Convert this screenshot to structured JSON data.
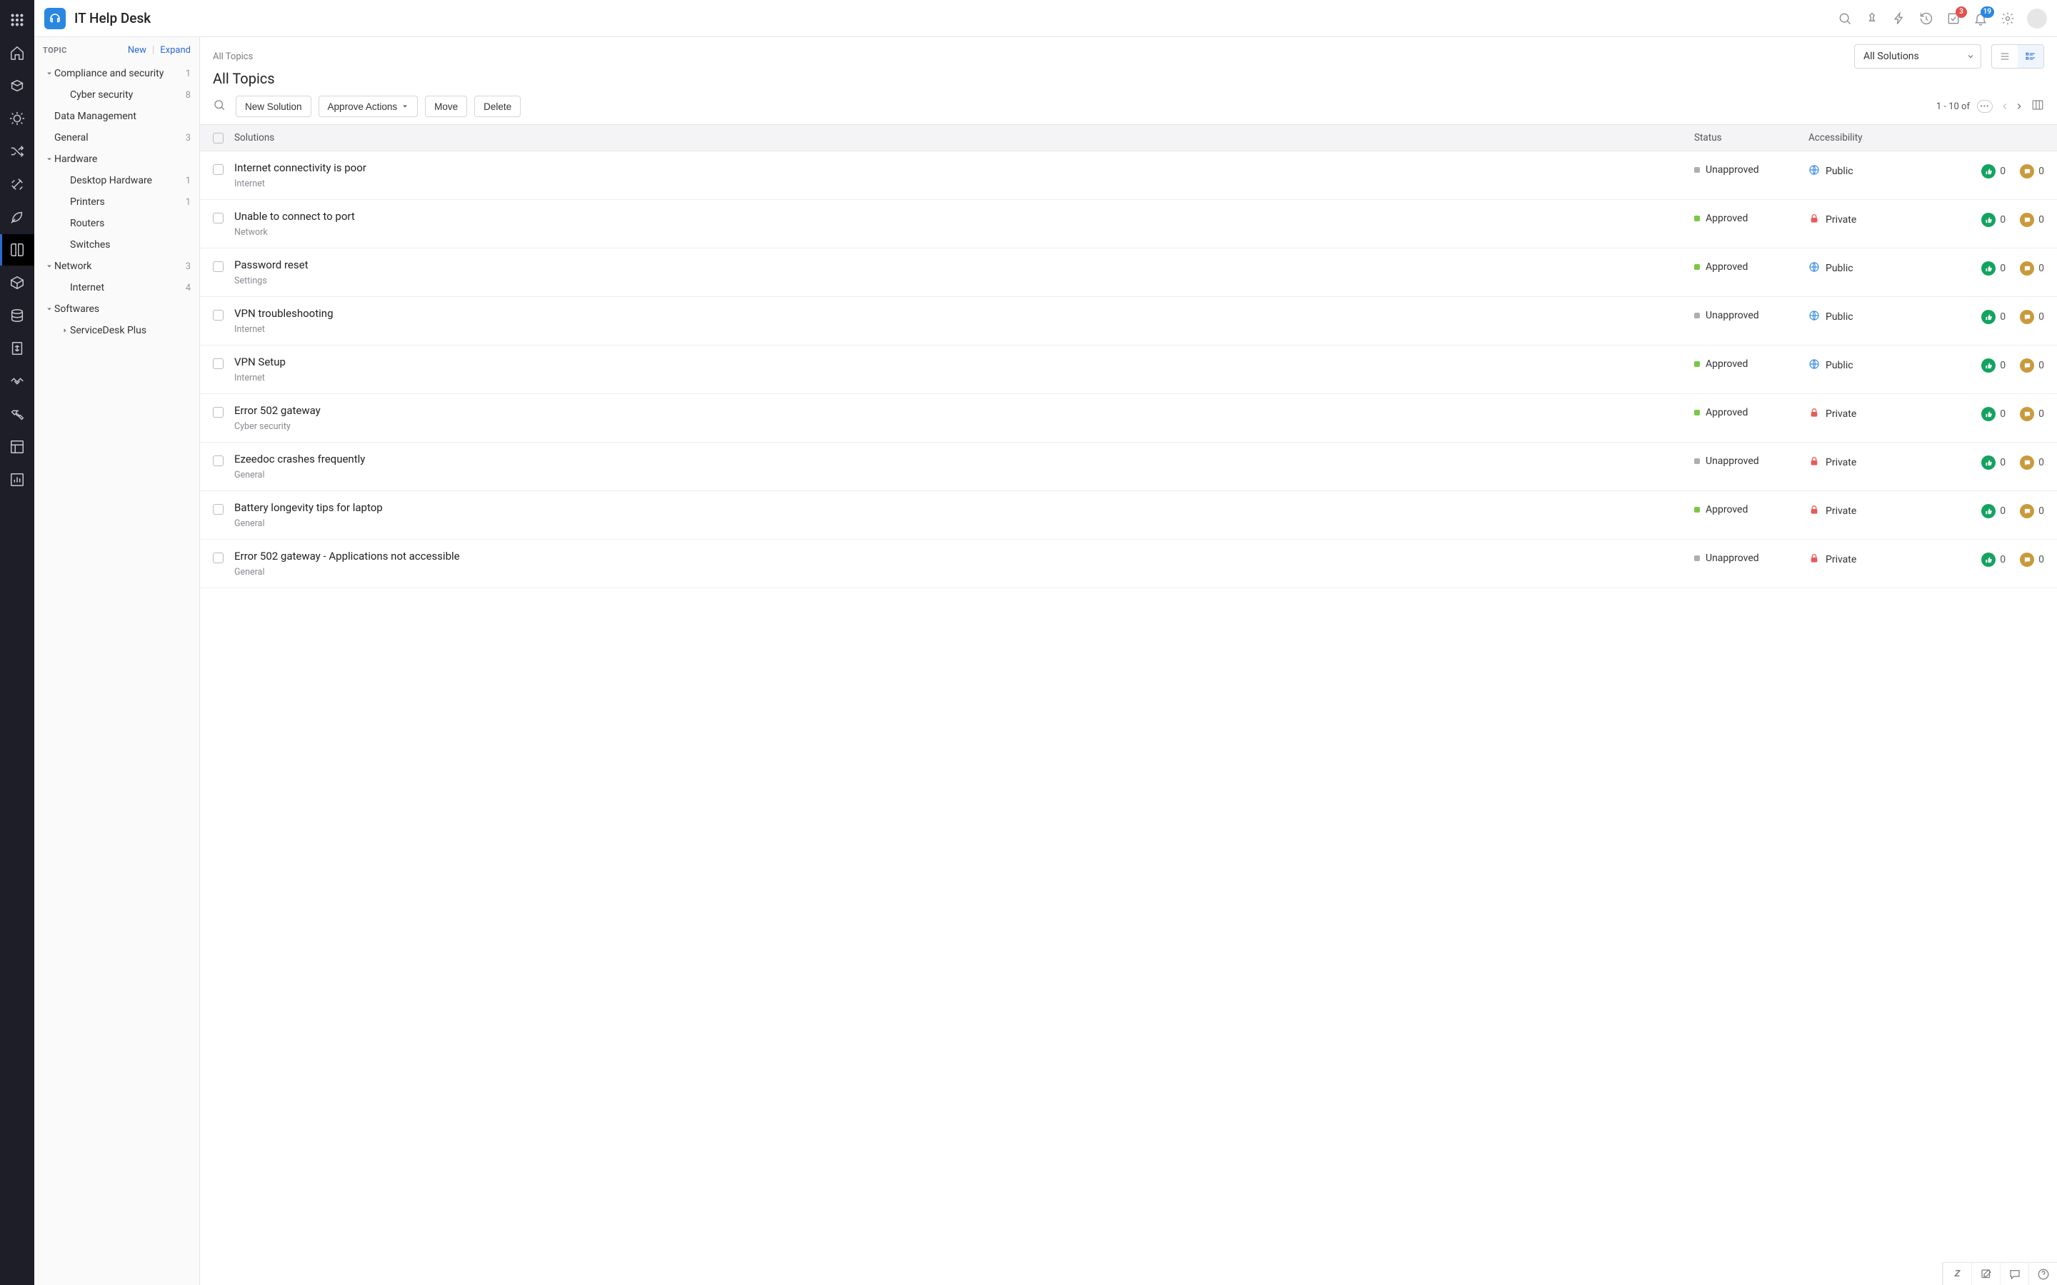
{
  "app": {
    "title": "IT Help Desk"
  },
  "header": {
    "approvals_badge": "3",
    "notifications_badge": "19"
  },
  "sidebar": {
    "title": "TOPIC",
    "new_link": "New",
    "expand_link": "Expand",
    "tree": [
      {
        "label": "Compliance and security",
        "count": "1",
        "level": 0,
        "chevron": "down"
      },
      {
        "label": "Cyber security",
        "count": "8",
        "level": 1
      },
      {
        "label": "Data Management",
        "count": "",
        "level": 0
      },
      {
        "label": "General",
        "count": "3",
        "level": 0
      },
      {
        "label": "Hardware",
        "count": "",
        "level": 0,
        "chevron": "down"
      },
      {
        "label": "Desktop Hardware",
        "count": "1",
        "level": 1
      },
      {
        "label": "Printers",
        "count": "1",
        "level": 1
      },
      {
        "label": "Routers",
        "count": "",
        "level": 1
      },
      {
        "label": "Switches",
        "count": "",
        "level": 1
      },
      {
        "label": "Network",
        "count": "3",
        "level": 0,
        "chevron": "down"
      },
      {
        "label": "Internet",
        "count": "4",
        "level": 1
      },
      {
        "label": "Softwares",
        "count": "",
        "level": 0,
        "chevron": "down"
      },
      {
        "label": "ServiceDesk Plus",
        "count": "",
        "level": 1,
        "chevron": "right"
      }
    ]
  },
  "content": {
    "breadcrumb": "All Topics",
    "page_title": "All Topics",
    "filter_selected": "All Solutions",
    "buttons": {
      "new_solution": "New Solution",
      "approve_actions": "Approve Actions",
      "move": "Move",
      "delete": "Delete"
    },
    "pager_text": "1 - 10 of",
    "columns": {
      "solutions": "Solutions",
      "status": "Status",
      "accessibility": "Accessibility"
    },
    "status_labels": {
      "approved": "Approved",
      "unapproved": "Unapproved"
    },
    "access_labels": {
      "public": "Public",
      "private": "Private"
    },
    "rows": [
      {
        "title": "Internet connectivity is poor",
        "category": "Internet",
        "status": "unapproved",
        "access": "public",
        "likes": "0",
        "comments": "0"
      },
      {
        "title": "Unable to connect to port",
        "category": "Network",
        "status": "approved",
        "access": "private",
        "likes": "0",
        "comments": "0"
      },
      {
        "title": "Password reset",
        "category": "Settings",
        "status": "approved",
        "access": "public",
        "likes": "0",
        "comments": "0"
      },
      {
        "title": "VPN troubleshooting",
        "category": "Internet",
        "status": "unapproved",
        "access": "public",
        "likes": "0",
        "comments": "0"
      },
      {
        "title": "VPN Setup",
        "category": "Internet",
        "status": "approved",
        "access": "public",
        "likes": "0",
        "comments": "0"
      },
      {
        "title": "Error 502 gateway",
        "category": "Cyber security",
        "status": "approved",
        "access": "private",
        "likes": "0",
        "comments": "0"
      },
      {
        "title": "Ezeedoc crashes frequently",
        "category": "General",
        "status": "unapproved",
        "access": "private",
        "likes": "0",
        "comments": "0"
      },
      {
        "title": "Battery longevity tips for laptop",
        "category": "General",
        "status": "approved",
        "access": "private",
        "likes": "0",
        "comments": "0"
      },
      {
        "title": "Error 502 gateway - Applications not accessible",
        "category": "General",
        "status": "unapproved",
        "access": "private",
        "likes": "0",
        "comments": "0"
      }
    ]
  }
}
